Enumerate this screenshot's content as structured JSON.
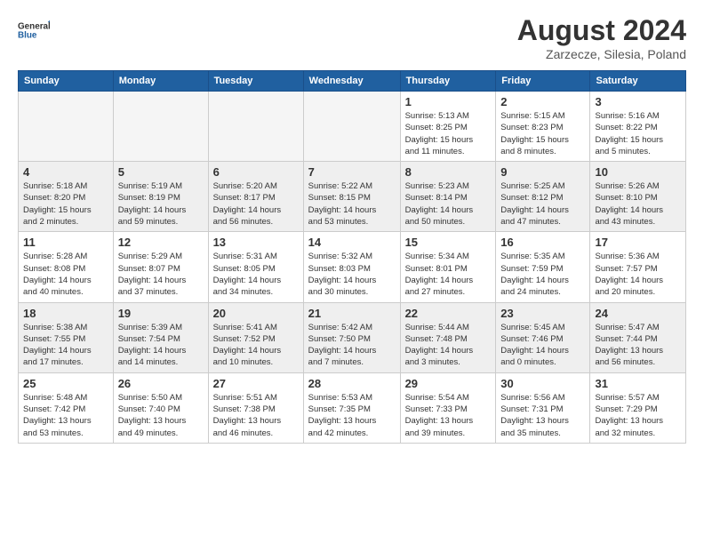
{
  "header": {
    "logo_general": "General",
    "logo_blue": "Blue",
    "month_title": "August 2024",
    "location": "Zarzecze, Silesia, Poland"
  },
  "weekdays": [
    "Sunday",
    "Monday",
    "Tuesday",
    "Wednesday",
    "Thursday",
    "Friday",
    "Saturday"
  ],
  "weeks": [
    [
      {
        "day": "",
        "info": ""
      },
      {
        "day": "",
        "info": ""
      },
      {
        "day": "",
        "info": ""
      },
      {
        "day": "",
        "info": ""
      },
      {
        "day": "1",
        "info": "Sunrise: 5:13 AM\nSunset: 8:25 PM\nDaylight: 15 hours\nand 11 minutes."
      },
      {
        "day": "2",
        "info": "Sunrise: 5:15 AM\nSunset: 8:23 PM\nDaylight: 15 hours\nand 8 minutes."
      },
      {
        "day": "3",
        "info": "Sunrise: 5:16 AM\nSunset: 8:22 PM\nDaylight: 15 hours\nand 5 minutes."
      }
    ],
    [
      {
        "day": "4",
        "info": "Sunrise: 5:18 AM\nSunset: 8:20 PM\nDaylight: 15 hours\nand 2 minutes."
      },
      {
        "day": "5",
        "info": "Sunrise: 5:19 AM\nSunset: 8:19 PM\nDaylight: 14 hours\nand 59 minutes."
      },
      {
        "day": "6",
        "info": "Sunrise: 5:20 AM\nSunset: 8:17 PM\nDaylight: 14 hours\nand 56 minutes."
      },
      {
        "day": "7",
        "info": "Sunrise: 5:22 AM\nSunset: 8:15 PM\nDaylight: 14 hours\nand 53 minutes."
      },
      {
        "day": "8",
        "info": "Sunrise: 5:23 AM\nSunset: 8:14 PM\nDaylight: 14 hours\nand 50 minutes."
      },
      {
        "day": "9",
        "info": "Sunrise: 5:25 AM\nSunset: 8:12 PM\nDaylight: 14 hours\nand 47 minutes."
      },
      {
        "day": "10",
        "info": "Sunrise: 5:26 AM\nSunset: 8:10 PM\nDaylight: 14 hours\nand 43 minutes."
      }
    ],
    [
      {
        "day": "11",
        "info": "Sunrise: 5:28 AM\nSunset: 8:08 PM\nDaylight: 14 hours\nand 40 minutes."
      },
      {
        "day": "12",
        "info": "Sunrise: 5:29 AM\nSunset: 8:07 PM\nDaylight: 14 hours\nand 37 minutes."
      },
      {
        "day": "13",
        "info": "Sunrise: 5:31 AM\nSunset: 8:05 PM\nDaylight: 14 hours\nand 34 minutes."
      },
      {
        "day": "14",
        "info": "Sunrise: 5:32 AM\nSunset: 8:03 PM\nDaylight: 14 hours\nand 30 minutes."
      },
      {
        "day": "15",
        "info": "Sunrise: 5:34 AM\nSunset: 8:01 PM\nDaylight: 14 hours\nand 27 minutes."
      },
      {
        "day": "16",
        "info": "Sunrise: 5:35 AM\nSunset: 7:59 PM\nDaylight: 14 hours\nand 24 minutes."
      },
      {
        "day": "17",
        "info": "Sunrise: 5:36 AM\nSunset: 7:57 PM\nDaylight: 14 hours\nand 20 minutes."
      }
    ],
    [
      {
        "day": "18",
        "info": "Sunrise: 5:38 AM\nSunset: 7:55 PM\nDaylight: 14 hours\nand 17 minutes."
      },
      {
        "day": "19",
        "info": "Sunrise: 5:39 AM\nSunset: 7:54 PM\nDaylight: 14 hours\nand 14 minutes."
      },
      {
        "day": "20",
        "info": "Sunrise: 5:41 AM\nSunset: 7:52 PM\nDaylight: 14 hours\nand 10 minutes."
      },
      {
        "day": "21",
        "info": "Sunrise: 5:42 AM\nSunset: 7:50 PM\nDaylight: 14 hours\nand 7 minutes."
      },
      {
        "day": "22",
        "info": "Sunrise: 5:44 AM\nSunset: 7:48 PM\nDaylight: 14 hours\nand 3 minutes."
      },
      {
        "day": "23",
        "info": "Sunrise: 5:45 AM\nSunset: 7:46 PM\nDaylight: 14 hours\nand 0 minutes."
      },
      {
        "day": "24",
        "info": "Sunrise: 5:47 AM\nSunset: 7:44 PM\nDaylight: 13 hours\nand 56 minutes."
      }
    ],
    [
      {
        "day": "25",
        "info": "Sunrise: 5:48 AM\nSunset: 7:42 PM\nDaylight: 13 hours\nand 53 minutes."
      },
      {
        "day": "26",
        "info": "Sunrise: 5:50 AM\nSunset: 7:40 PM\nDaylight: 13 hours\nand 49 minutes."
      },
      {
        "day": "27",
        "info": "Sunrise: 5:51 AM\nSunset: 7:38 PM\nDaylight: 13 hours\nand 46 minutes."
      },
      {
        "day": "28",
        "info": "Sunrise: 5:53 AM\nSunset: 7:35 PM\nDaylight: 13 hours\nand 42 minutes."
      },
      {
        "day": "29",
        "info": "Sunrise: 5:54 AM\nSunset: 7:33 PM\nDaylight: 13 hours\nand 39 minutes."
      },
      {
        "day": "30",
        "info": "Sunrise: 5:56 AM\nSunset: 7:31 PM\nDaylight: 13 hours\nand 35 minutes."
      },
      {
        "day": "31",
        "info": "Sunrise: 5:57 AM\nSunset: 7:29 PM\nDaylight: 13 hours\nand 32 minutes."
      }
    ]
  ]
}
